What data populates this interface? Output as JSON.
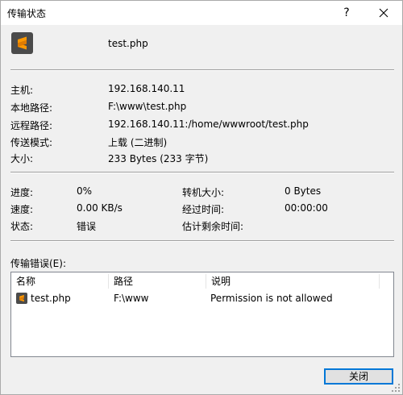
{
  "window": {
    "title": "传输状态",
    "help_glyph": "?"
  },
  "header": {
    "filename": "test.php"
  },
  "info": {
    "host_label": "主机:",
    "host_value": "192.168.140.11",
    "local_path_label": "本地路径:",
    "local_path_value": "F:\\www\\test.php",
    "remote_path_label": "远程路径:",
    "remote_path_value": "192.168.140.11:/home/wwwroot/test.php",
    "mode_label": "传送模式:",
    "mode_value": "上载 (二进制)",
    "size_label": "大小:",
    "size_value": "233 Bytes (233 字节)"
  },
  "progress": {
    "progress_label": "进度:",
    "progress_value": "0%",
    "speed_label": "速度:",
    "speed_value": "0.00 KB/s",
    "status_label": "状态:",
    "status_value": "错误",
    "transferred_label": "转机大小:",
    "transferred_value": "0 Bytes",
    "elapsed_label": "经过时间:",
    "elapsed_value": "00:00:00",
    "remaining_label": "估计剩余时间:",
    "remaining_value": ""
  },
  "errors": {
    "label": "传输错误(E):",
    "columns": [
      "名称",
      "路径",
      "说明"
    ],
    "rows": [
      {
        "name": "test.php",
        "path": "F:\\www",
        "description": "Permission is not allowed"
      }
    ]
  },
  "buttons": {
    "close_label": "关闭"
  },
  "colors": {
    "accent": "#0078d7",
    "icon_bg": "#4b4b4b",
    "icon_fg": "#ff9800"
  }
}
